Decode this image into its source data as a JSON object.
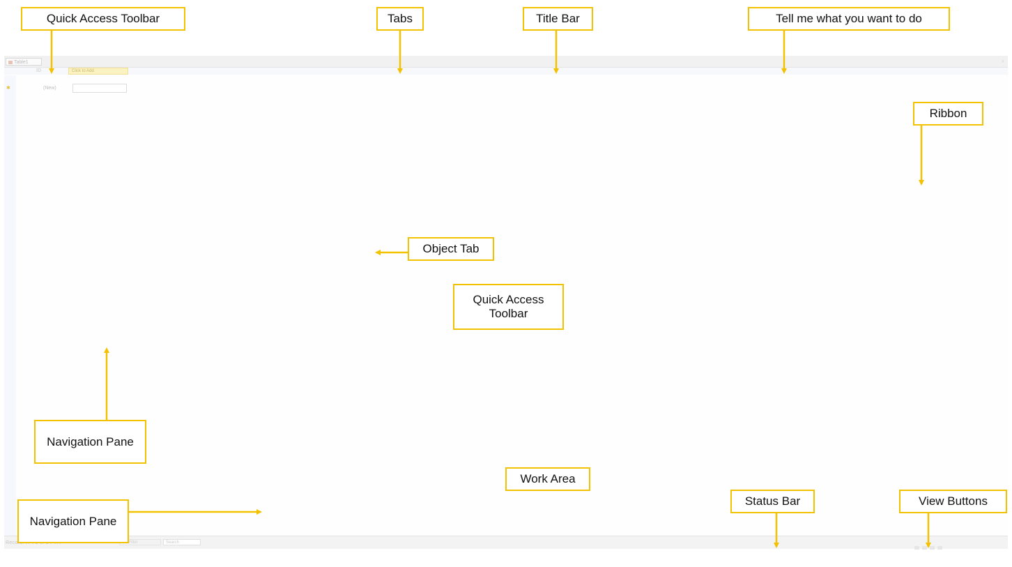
{
  "access_window": {
    "object_tab_label": "Table1",
    "field_header_id": "ID",
    "field_header_add": "Click to Add",
    "new_row_label": "(New)",
    "status": {
      "record_nav": "Record: H  ◂  1 of 1  ▸  H  ▸*",
      "filter": "No Filter",
      "search": "Search"
    }
  },
  "callouts": {
    "quick_access_toolbar_top": "Quick Access Toolbar",
    "tabs": "Tabs",
    "title_bar": "Title Bar",
    "tell_me": "Tell me what you want to do",
    "ribbon": "Ribbon",
    "object_tab": "Object Tab",
    "quick_access_toolbar_center": "Quick Access Toolbar",
    "navigation_pane_left": "Navigation Pane",
    "work_area": "Work Area",
    "navigation_pane_bottom": "Navigation Pane",
    "status_bar": "Status Bar",
    "view_buttons": "View Buttons"
  },
  "colors": {
    "callout_border": "#f2c200",
    "arrow": "#f2c200"
  }
}
